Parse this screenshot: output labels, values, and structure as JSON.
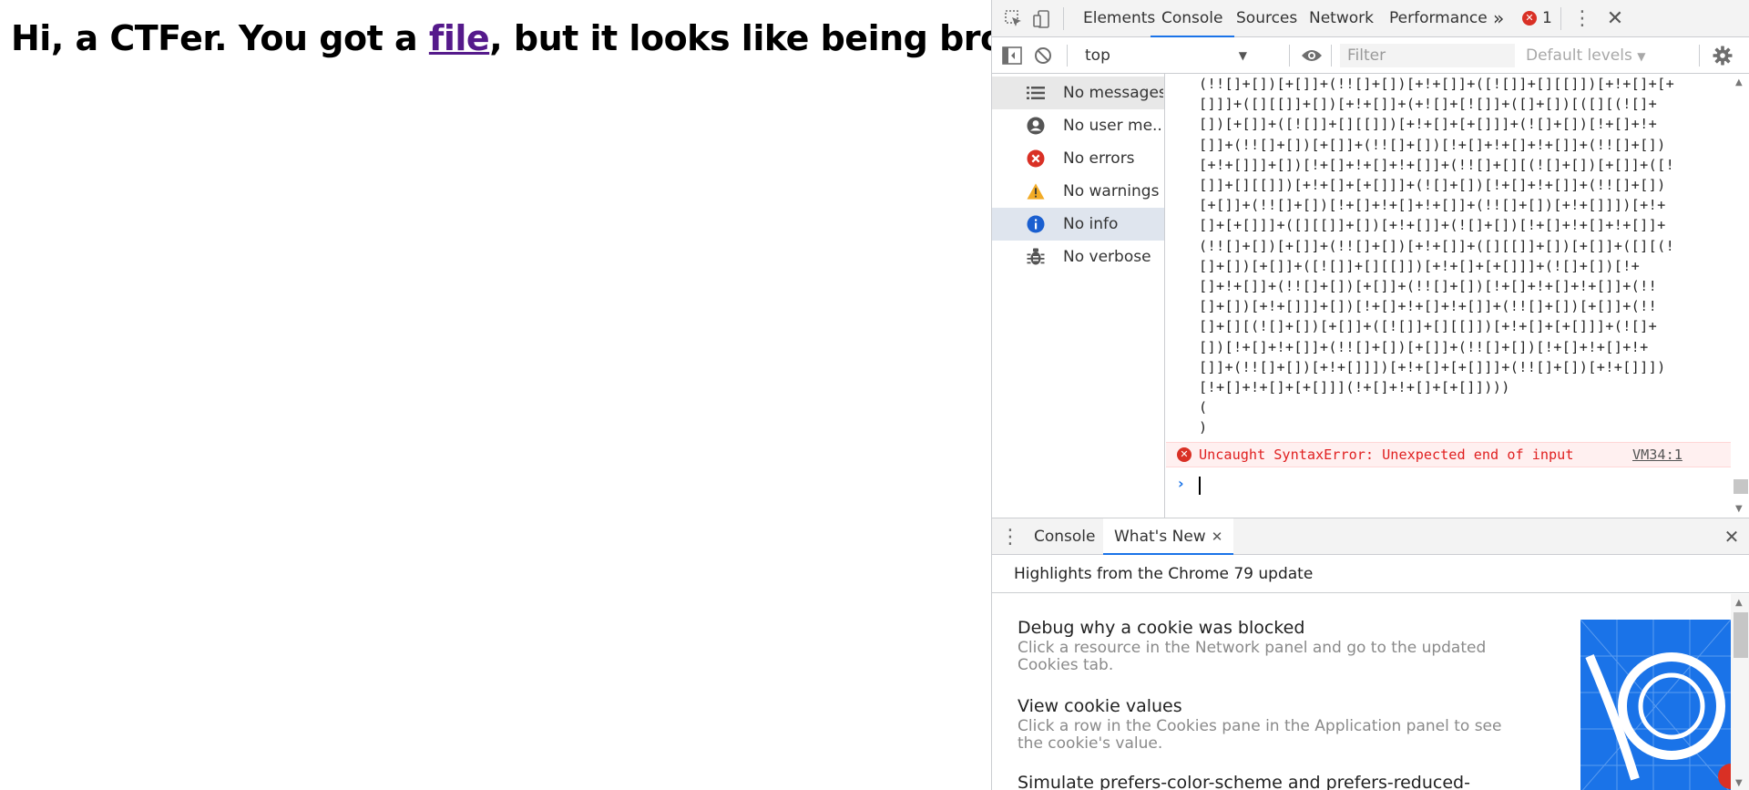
{
  "page": {
    "heading_before": "Hi, a CTFer. You got a ",
    "heading_link": "file",
    "heading_after": ", but it looks like being broken."
  },
  "devtools": {
    "tabs": [
      "Elements",
      "Console",
      "Sources",
      "Network",
      "Performance"
    ],
    "active_tab": "Console",
    "more_tabs_label": "»",
    "error_count": "1",
    "context": "top",
    "filter_placeholder": "Filter",
    "levels_label": "Default levels",
    "sidebar": [
      {
        "label": "No messages",
        "icon": "list-icon"
      },
      {
        "label": "No user me...",
        "icon": "user-icon"
      },
      {
        "label": "No errors",
        "icon": "error-icon"
      },
      {
        "label": "No warnings",
        "icon": "warning-icon"
      },
      {
        "label": "No info",
        "icon": "info-icon"
      },
      {
        "label": "No verbose",
        "icon": "bug-icon"
      }
    ],
    "code_lines": [
      "(!![]+[])[+[]]+(!![]+[])[+!+[]]+([![]]+[][[]])[+!+[]+[+",
      "[]]]+([][[]]+[])[+!+[]]+(+![]+[![]]+([]+[])[([][(![]+",
      "[])[+[]]+([![]]+[][[]])[+!+[]+[+[]]]+(![]+[])[!+[]+!+",
      "[]]+(!![]+[])[+[]]+(!![]+[])[!+[]+!+[]+!+[]]+(!![]+[])",
      "[+!+[]]]+[])[!+[]+!+[]+!+[]]+(!![]+[][(![]+[])[+[]]+([!",
      "[]]+[][[]])[+!+[]+[+[]]]+(![]+[])[!+[]+!+[]]+(!![]+[])",
      "[+[]]+(!![]+[])[!+[]+!+[]+!+[]]+(!![]+[])[+!+[]]])[+!+",
      "[]+[+[]]]+([][[]]+[])[+!+[]]+(![]+[])[!+[]+!+[]+!+[]]+",
      "(!![]+[])[+[]]+(!![]+[])[+!+[]]+([][[]]+[])[+[]]+([][(!",
      "[]+[])[+[]]+([![]]+[][[]])[+!+[]+[+[]]]+(![]+[])[!+",
      "[]+!+[]]+(!![]+[])[+[]]+(!![]+[])[!+[]+!+[]+!+[]]+(!!",
      "[]+[])[+!+[]]]+[])[!+[]+!+[]+!+[]]+(!![]+[])[+[]]+(!!",
      "[]+[][(![]+[])[+[]]+([![]]+[][[]])[+!+[]+[+[]]]+(![]+",
      "[])[!+[]+!+[]]+(!![]+[])[+[]]+(!![]+[])[!+[]+!+[]+!+",
      "[]]+(!![]+[])[+!+[]]])[+!+[]+[+[]]]+(!![]+[])[+!+[]]])",
      "[!+[]+!+[]+[+[]]](!+[]+!+[]+[+[]])))",
      "(",
      ")"
    ],
    "error_message": "Uncaught SyntaxError: Unexpected end of input",
    "error_source": "VM34:1",
    "prompt": "›",
    "drawer_tabs": [
      "Console",
      "What's New"
    ],
    "drawer_active": "What's New",
    "drawer_highlights": "Highlights from the Chrome 79 update",
    "features": [
      {
        "title": "Debug why a cookie was blocked",
        "desc": "Click a resource in the Network panel and go to the updated Cookies tab."
      },
      {
        "title": "View cookie values",
        "desc": "Click a row in the Cookies pane in the Application panel to see the cookie's value."
      },
      {
        "title": "Simulate prefers-color-scheme and prefers-reduced-",
        "desc": ""
      }
    ],
    "colors": {
      "accent": "#1a73e8",
      "error": "#d93025",
      "warning": "#f2ab26",
      "link_visited": "#551a8b"
    }
  }
}
